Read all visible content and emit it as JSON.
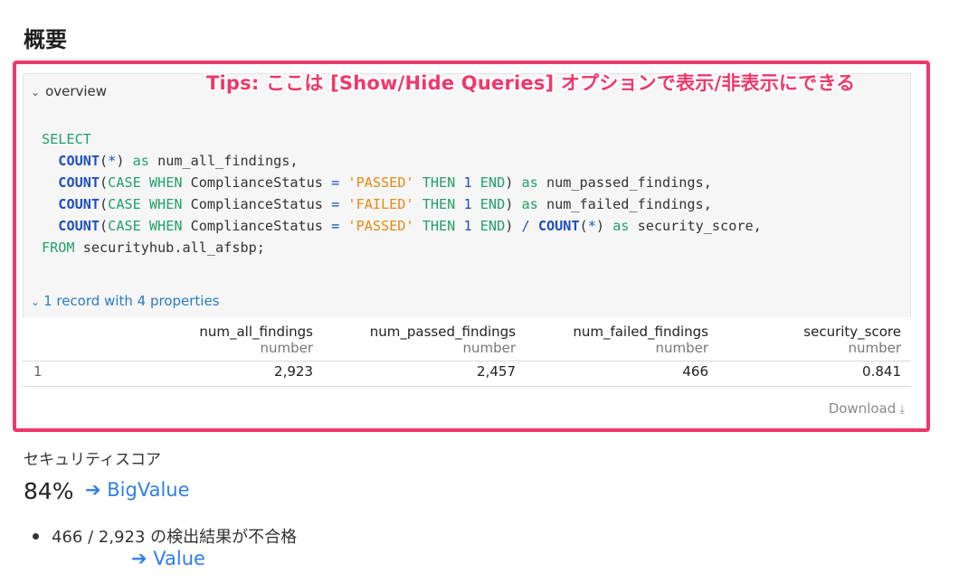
{
  "page": {
    "title": "概要"
  },
  "tips": "Tips: ここは [Show/Hide Queries] オプションで表示/非表示にできる",
  "query": {
    "toggle_label": "overview",
    "code": {
      "select": "SELECT",
      "count": "COUNT",
      "case": "CASE",
      "when": "WHEN",
      "then": "THEN",
      "end": "END",
      "as": "as",
      "from": "FROM",
      "star": "*",
      "one": "1",
      "eq": "=",
      "div": "/",
      "col": "ComplianceStatus",
      "passed": "'PASSED'",
      "failed": "'FAILED'",
      "a1": "num_all_findings",
      "a2": "num_passed_findings",
      "a3": "num_failed_findings",
      "a4": "security_score",
      "table": "securityhub.all_afsbp;"
    }
  },
  "results": {
    "toggle_label": "1 record with 4 properties",
    "columns": [
      {
        "name": "num_all_findings",
        "type": "number"
      },
      {
        "name": "num_passed_findings",
        "type": "number"
      },
      {
        "name": "num_failed_findings",
        "type": "number"
      },
      {
        "name": "security_score",
        "type": "number"
      }
    ],
    "rows": [
      {
        "index": "1",
        "values": [
          "2,923",
          "2,457",
          "466",
          "0.841"
        ]
      }
    ],
    "download_label": "Download"
  },
  "score": {
    "label": "セキュリティスコア",
    "big_value": "84%",
    "big_value_note": "➔ BigValue",
    "bullet": "466 / 2,923 の検出結果が不合格",
    "value_note": "➔ Value"
  },
  "colors": {
    "highlight": "#f0386b",
    "annotation": "#2f7fe4",
    "link": "#2b7bc4"
  }
}
